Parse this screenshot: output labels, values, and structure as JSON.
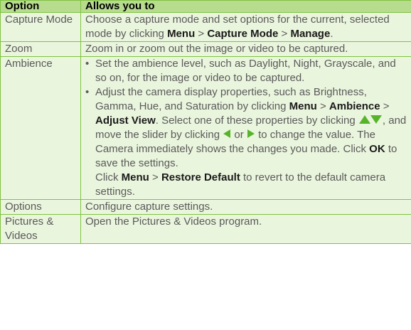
{
  "header": {
    "col1": "Option",
    "col2": "Allows you to"
  },
  "rows": [
    {
      "option": "Capture Mode",
      "desc": {
        "t1": "Choose a capture mode and set options for the current, selected mode by clicking ",
        "b1": "Menu",
        "s1": " > ",
        "b2": "Capture Mode",
        "s2": " > ",
        "b3": "Manage",
        "end": "."
      }
    },
    {
      "option": "Zoom",
      "desc": "Zoom in or zoom out the image or video to be captured."
    },
    {
      "option": "Ambience",
      "bullet_char": "•",
      "bullet1": "Set the ambience level, such as Daylight, Night, Grayscale, and so on, for the image or video to be captured.",
      "bullet2": {
        "t1": "Adjust the camera display properties, such as Brightness, Gamma, Hue, and Saturation by clicking ",
        "b1": "Menu",
        "s1": " > ",
        "b2": "Ambience",
        "s2": " > ",
        "b3": "Adjust View",
        "t2": ". Select one of these properties by clicking ",
        "t3": ", and move the slider by clicking ",
        "t4": " or ",
        "t5": " to change the value. The Camera immediately shows the changes you made. Click ",
        "b4": "OK",
        "t6": " to save the settings."
      },
      "extra": {
        "t1": "Click ",
        "b1": "Menu",
        "s1": " > ",
        "b2": "Restore Default",
        "t2": " to revert to the default camera settings."
      }
    },
    {
      "option": "Options",
      "desc": "Configure capture settings."
    },
    {
      "option": "Pictures & Videos",
      "desc": "Open the Pictures & Videos program."
    }
  ],
  "icons": {
    "up_down": "up-down-arrows-icon",
    "left": "left-arrow-icon",
    "right": "right-arrow-icon"
  },
  "colors": {
    "border": "#7fc241",
    "header_bg": "#b7dc8e",
    "row_bg": "#eaf5dd",
    "icon_fill": "#57b42a"
  }
}
